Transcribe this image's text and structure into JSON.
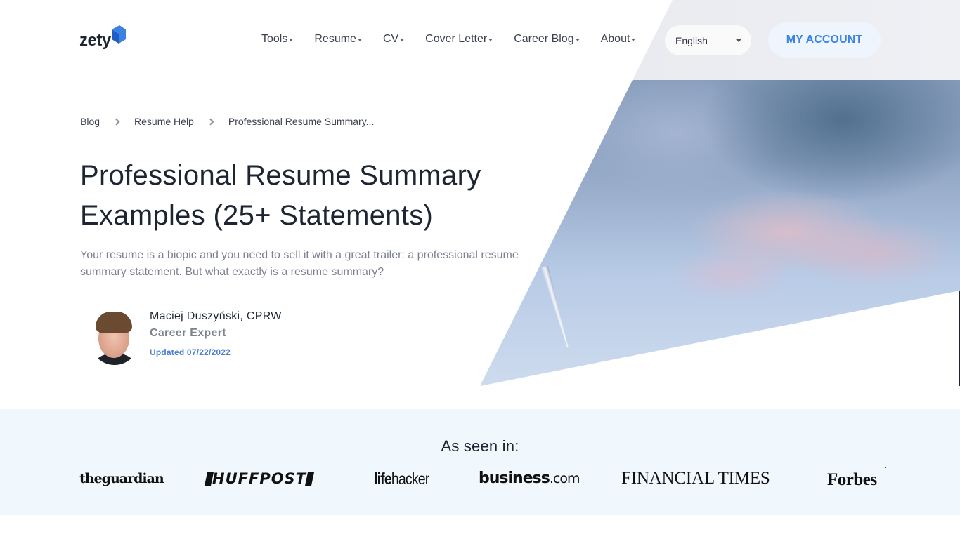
{
  "header": {
    "logo_text": "zety",
    "nav": [
      {
        "label": "Tools"
      },
      {
        "label": "Resume"
      },
      {
        "label": "CV"
      },
      {
        "label": "Cover Letter"
      },
      {
        "label": "Career Blog"
      },
      {
        "label": "About"
      }
    ],
    "language": {
      "selected": "English"
    },
    "account_button": "MY ACCOUNT"
  },
  "breadcrumb": [
    {
      "label": "Blog"
    },
    {
      "label": "Resume Help"
    },
    {
      "label": "Professional Resume Summary..."
    }
  ],
  "article": {
    "title": "Professional Resume Summary Examples (25+ Statements)",
    "lead": "Your resume is a biopic and you need to sell it with a great trailer: a professional resume summary statement. But what exactly is a resume summary?",
    "author": {
      "name": "Maciej Duszyński, CPRW",
      "role": "Career Expert",
      "updated": "Updated 07/22/2022"
    }
  },
  "press": {
    "title": "As seen in:",
    "logos": [
      {
        "name": "theguardian"
      },
      {
        "name": "HUFFPOST"
      },
      {
        "name_bold": "life",
        "name_rest": "hacker"
      },
      {
        "name_bold": "business",
        "name_rest": ".com"
      },
      {
        "name": "FINANCIAL TIMES"
      },
      {
        "name": "Forbes"
      }
    ]
  },
  "colors": {
    "accent": "#3b82e3",
    "text_dark": "#1e2532",
    "text_muted": "#7d8290",
    "band_bg": "#f0f7fd"
  }
}
